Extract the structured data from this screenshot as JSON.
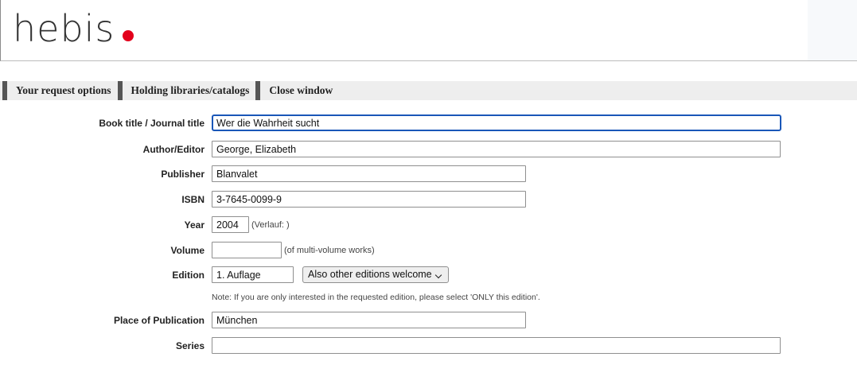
{
  "brand": {
    "logo_text": "hebis",
    "dot_color": "#e3001b"
  },
  "nav": {
    "items": [
      {
        "label": "Your request options"
      },
      {
        "label": "Holding libraries/catalogs"
      },
      {
        "label": "Close window"
      }
    ]
  },
  "form": {
    "title": {
      "label": "Book title / Journal title",
      "value": "Wer die Wahrheit sucht"
    },
    "author": {
      "label": "Author/Editor",
      "value": "George, Elizabeth"
    },
    "publisher": {
      "label": "Publisher",
      "value": "Blanvalet"
    },
    "isbn": {
      "label": "ISBN",
      "value": "3-7645-0099-9"
    },
    "year": {
      "label": "Year",
      "value": "2004",
      "hint": "(Verlauf: )"
    },
    "volume": {
      "label": "Volume",
      "value": "",
      "hint": "(of multi-volume works)"
    },
    "edition": {
      "label": "Edition",
      "value": "1. Auflage",
      "select_value": "Also other editions welcome"
    },
    "note": "Note: If you are only interested in the requested edition, please select 'ONLY this edition'.",
    "place": {
      "label": "Place of Publication",
      "value": "München"
    },
    "series": {
      "label": "Series",
      "value": ""
    }
  }
}
